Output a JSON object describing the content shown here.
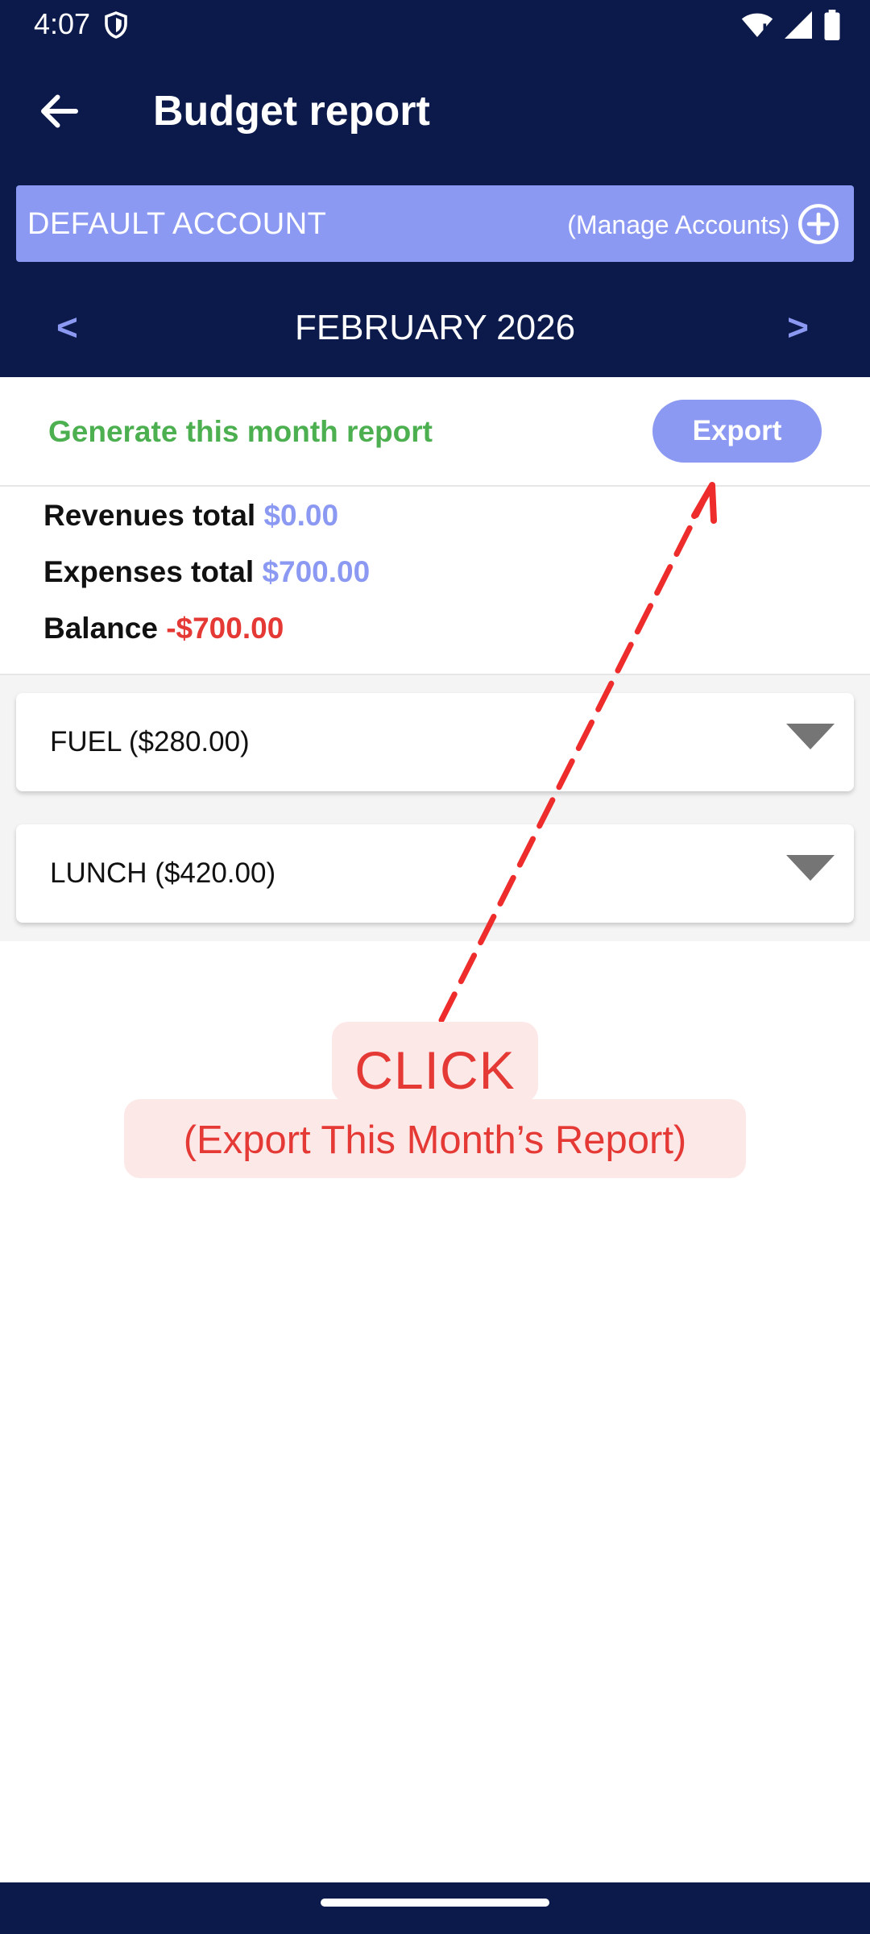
{
  "status_bar": {
    "time": "4:07",
    "icons": [
      "shield-icon",
      "wifi-icon",
      "signal-icon",
      "battery-icon"
    ]
  },
  "app_bar": {
    "back_icon": "arrow-left-icon",
    "title": "Budget report"
  },
  "account": {
    "name": "DEFAULT ACCOUNT",
    "manage_label": "(Manage Accounts)",
    "add_icon": "add-circle-icon"
  },
  "month_nav": {
    "prev": "<",
    "month": "FEBRUARY 2026",
    "next": ">"
  },
  "report": {
    "generate_label": "Generate this month report",
    "export_label": "Export"
  },
  "totals": {
    "revenues_label": "Revenues total",
    "revenues_value": "$0.00",
    "expenses_label": "Expenses total",
    "expenses_value": "$700.00",
    "balance_label": "Balance",
    "balance_value": "-$700.00"
  },
  "categories": [
    {
      "label": "FUEL ($280.00)"
    },
    {
      "label": "LUNCH ($420.00)"
    }
  ],
  "annotation": {
    "title": "CLICK",
    "subtitle": "(Export This Month’s Report)"
  },
  "colors": {
    "header_bg": "#0b1a4a",
    "accent": "#8c99f2",
    "positive": "#4caf50",
    "negative": "#e53935"
  }
}
